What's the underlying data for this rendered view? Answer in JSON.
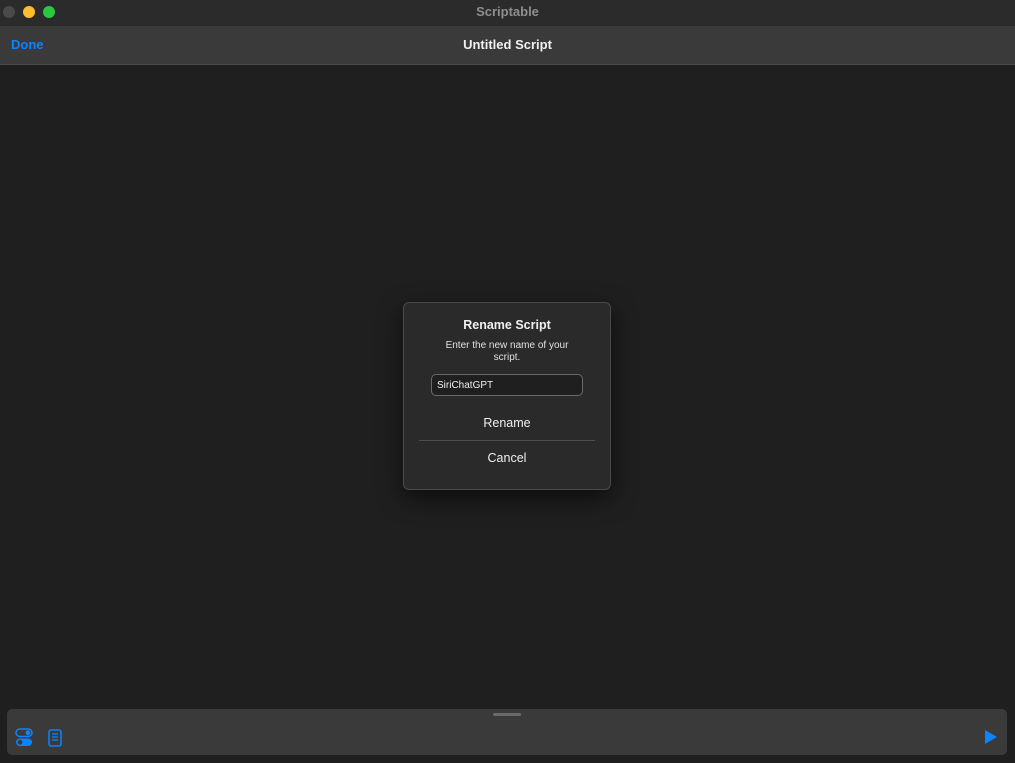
{
  "window": {
    "app_title": "Scriptable"
  },
  "navbar": {
    "done_label": "Done",
    "title": "Untitled Script"
  },
  "dialog": {
    "title": "Rename Script",
    "message": "Enter the new name of your script.",
    "input_value": "SiriChatGPT",
    "rename_label": "Rename",
    "cancel_label": "Cancel"
  },
  "toolbar": {
    "icons": [
      "settings-toggle-icon",
      "document-icon",
      "play-icon"
    ]
  },
  "colors": {
    "accent": "#0a84ff",
    "background": "#1f1f1f",
    "bar": "#3a3a3a",
    "traffic_close": "#4a4a4a",
    "traffic_minimize": "#febc2e",
    "traffic_maximize": "#28c840"
  }
}
